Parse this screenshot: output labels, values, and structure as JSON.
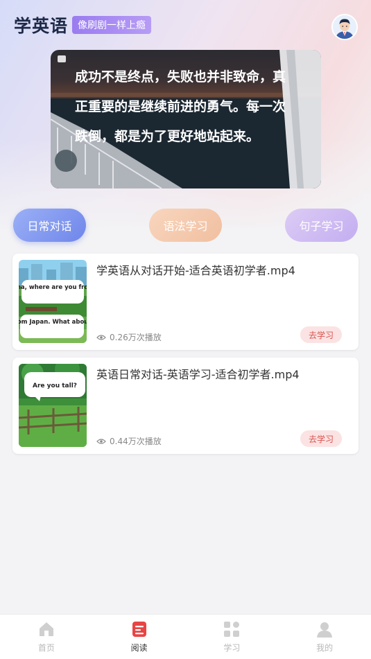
{
  "header": {
    "app_title": "学英语",
    "slogan": "像刷剧一样上瘾"
  },
  "banner": {
    "quote": "成功不是终点，失败也并非致命，真正重要的是继续前进的勇气。每一次跌倒，都是为了更好地站起来。"
  },
  "categories": [
    {
      "label": "日常对话"
    },
    {
      "label": "语法学习"
    },
    {
      "label": "句子学习"
    }
  ],
  "videos": [
    {
      "title": "学英语从对话开始-适合英语初学者.mp4",
      "views": "0.26万次播放",
      "action": "去学习",
      "thumb_bubbles": [
        "Hana, where are you from?",
        "I am from Japan. What about you?"
      ]
    },
    {
      "title": "英语日常对话-英语学习-适合初学者.mp4",
      "views": "0.44万次播放",
      "action": "去学习",
      "thumb_bubbles": [
        "Are you tall?"
      ]
    }
  ],
  "tabbar": {
    "items": [
      {
        "label": "首页",
        "icon": "home-icon"
      },
      {
        "label": "阅读",
        "icon": "book-icon"
      },
      {
        "label": "学习",
        "icon": "grid-icon"
      },
      {
        "label": "我的",
        "icon": "user-icon"
      }
    ],
    "active_index": 1
  },
  "colors": {
    "accent_red": "#e84545",
    "pill_blue": "#7a8ff0",
    "slogan_purple": "#a486f2"
  }
}
